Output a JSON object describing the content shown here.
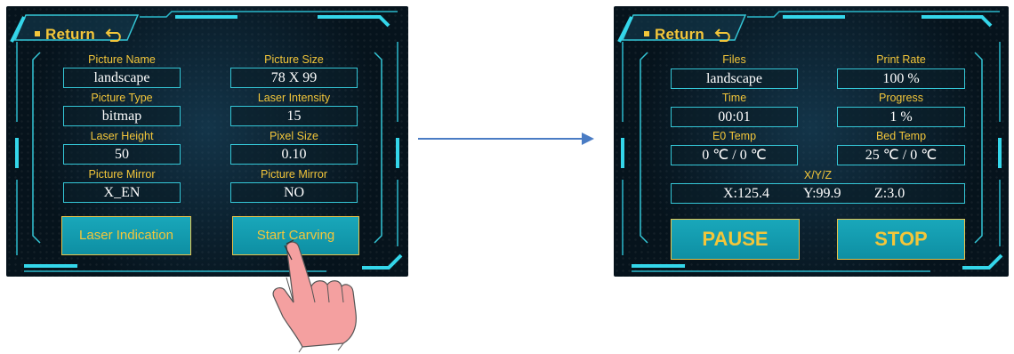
{
  "left_screen": {
    "return_label": "Return",
    "fields": [
      {
        "label": "Picture Name",
        "value": "landscape"
      },
      {
        "label": "Picture Size",
        "value": "78 X 99"
      },
      {
        "label": "Picture Type",
        "value": "bitmap"
      },
      {
        "label": "Laser Intensity",
        "value": "15"
      },
      {
        "label": "Laser Height",
        "value": "50"
      },
      {
        "label": "Pixel Size",
        "value": "0.10"
      },
      {
        "label": "Picture Mirror",
        "value": "X_EN"
      },
      {
        "label": "Picture Mirror",
        "value": "NO"
      }
    ],
    "laser_indication_label": "Laser Indication",
    "start_carving_label": "Start Carving"
  },
  "right_screen": {
    "return_label": "Return",
    "fields": [
      {
        "label": "Files",
        "value": "landscape"
      },
      {
        "label": "Print Rate",
        "value": "100 %"
      },
      {
        "label": "Time",
        "value": "00:01"
      },
      {
        "label": "Progress",
        "value": "1  %"
      },
      {
        "label": "E0 Temp",
        "value": "0 ℃ /   0  ℃"
      },
      {
        "label": "Bed Temp",
        "value": "25 ℃ /   0  ℃"
      }
    ],
    "xyz_label": "X/Y/Z",
    "x_value": "X:125.4",
    "y_value": "Y:99.9",
    "z_value": "Z:3.0",
    "pause_label": "PAUSE",
    "stop_label": "STOP"
  },
  "colors": {
    "accent_yellow": "#f3c63a",
    "frame_cyan": "#34c6d6",
    "button_teal": "#14a0b4",
    "arrow_blue": "#4a7cc4",
    "hand_pink": "#f4a0a0"
  },
  "icons": [
    "return-arrow-icon",
    "pointing-hand-icon",
    "transition-arrow-icon"
  ]
}
